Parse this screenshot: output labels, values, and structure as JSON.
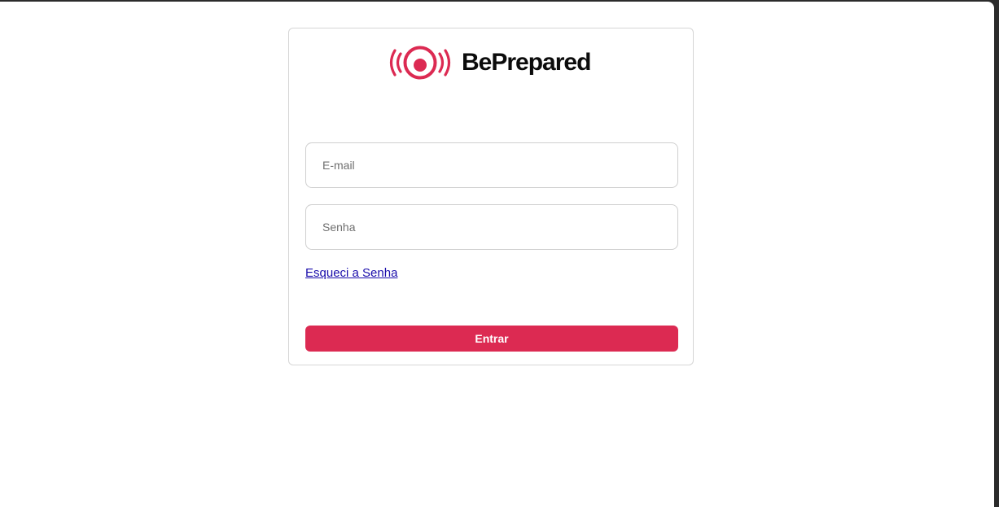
{
  "brand": {
    "name": "BePrepared",
    "logo_icon": "broadcast-signal-icon",
    "accent_color": "#dc2a52"
  },
  "login": {
    "email_placeholder": "E-mail",
    "password_placeholder": "Senha",
    "forgot_password_label": "Esqueci a Senha",
    "submit_label": "Entrar"
  }
}
